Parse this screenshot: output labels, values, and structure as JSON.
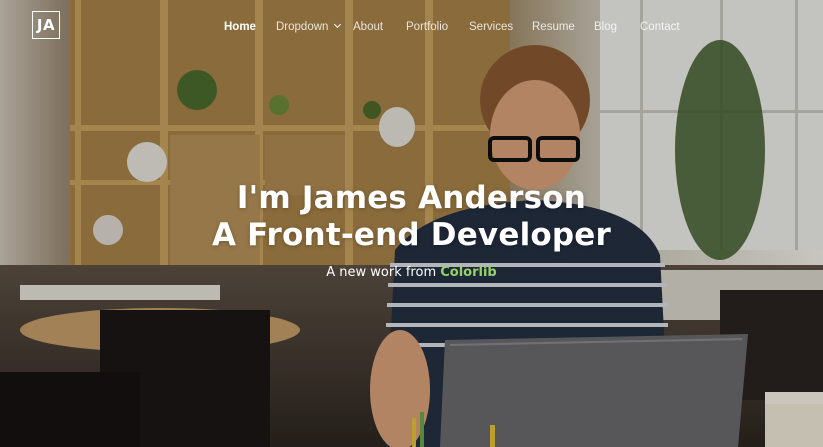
{
  "logo": {
    "text": "JA"
  },
  "nav": {
    "items": [
      {
        "label": "Home",
        "active": true
      },
      {
        "label": "Dropdown",
        "has_submenu": true
      },
      {
        "label": "About"
      },
      {
        "label": "Portfolio"
      },
      {
        "label": "Services"
      },
      {
        "label": "Resume"
      },
      {
        "label": "Blog"
      },
      {
        "label": "Contact"
      }
    ]
  },
  "hero": {
    "title_line1": "I'm James Anderson",
    "title_line2": "A Front-end Developer",
    "subtitle_prefix": "A new work from",
    "subtitle_link": "Colorlib"
  },
  "colors": {
    "accent_green": "#96d26a",
    "text": "#ffffff"
  }
}
